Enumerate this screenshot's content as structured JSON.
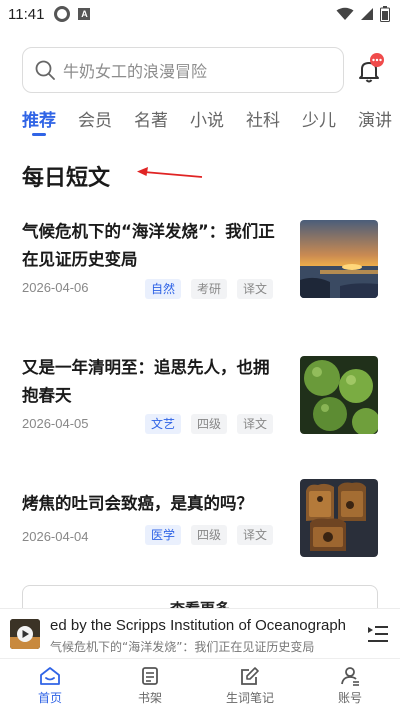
{
  "status_bar": {
    "time": "11:41",
    "a_icon": "A"
  },
  "search": {
    "placeholder": "牛奶女工的浪漫冒险"
  },
  "notification": {
    "badge": "···"
  },
  "tabs": [
    "推荐",
    "会员",
    "名著",
    "小说",
    "社科",
    "少儿",
    "演讲"
  ],
  "section": {
    "title": "每日短文"
  },
  "articles": [
    {
      "title": "气候危机下的“海洋发烧”：我们正在见证历史变局",
      "date": "2026-04-06",
      "tags": [
        "自然",
        "考研",
        "译文"
      ],
      "thumb": "sunset-sea-icon"
    },
    {
      "title": "又是一年清明至：追思先人，也拥抱春天",
      "date": "2026-04-05",
      "tags": [
        "文艺",
        "四级",
        "译文"
      ],
      "thumb": "green-dumplings-icon"
    },
    {
      "title": "烤焦的吐司会致癌，是真的吗？",
      "date": "2026-04-04",
      "tags": [
        "医学",
        "四级",
        "译文"
      ],
      "thumb": "burnt-toast-icon"
    }
  ],
  "more_button": "查看更多",
  "player": {
    "line1": "ed by the Scripps Institution of Oceanograph",
    "line2": "气候危机下的“海洋发烧”：我们正在见证历史变局"
  },
  "bottom_nav": [
    {
      "label": "首页",
      "icon": "home-icon"
    },
    {
      "label": "书架",
      "icon": "bookshelf-icon"
    },
    {
      "label": "生词笔记",
      "icon": "notes-icon"
    },
    {
      "label": "账号",
      "icon": "account-icon"
    }
  ],
  "colors": {
    "accent": "#3064e6",
    "badge": "#f04b4b",
    "arrow": "#e02424"
  }
}
